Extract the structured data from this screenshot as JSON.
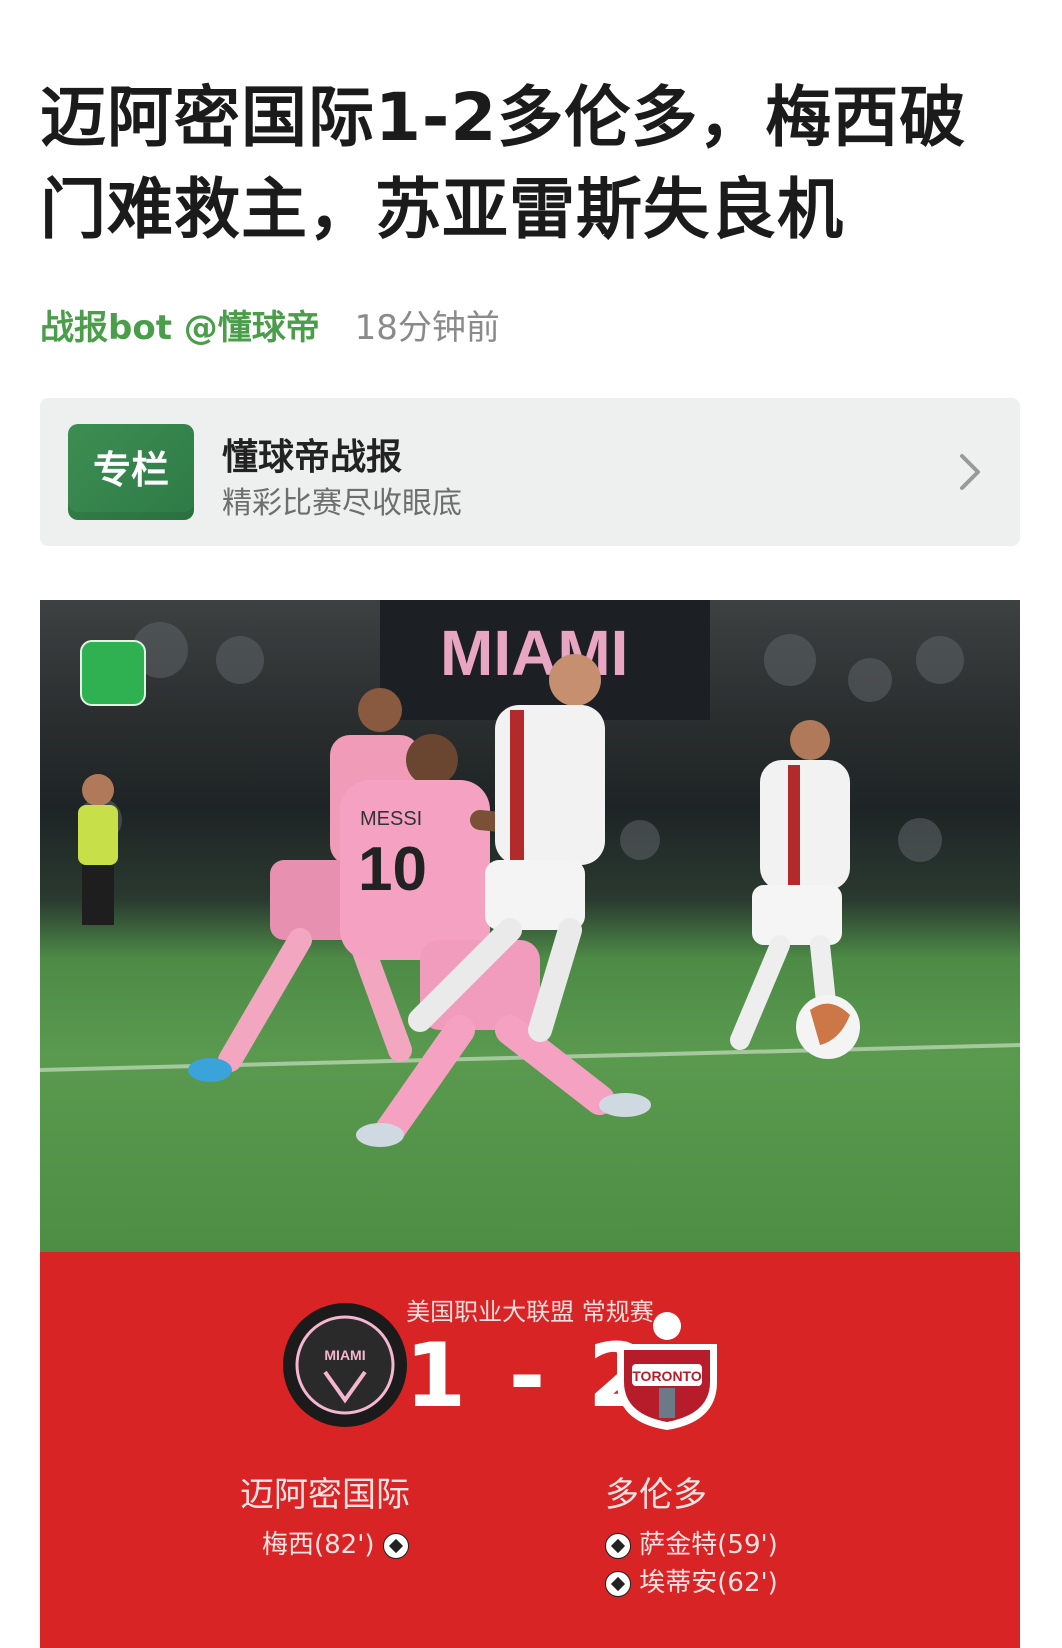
{
  "article": {
    "title": "迈阿密国际1-2多伦多，梅西破门难救主，苏亚雷斯失良机",
    "author": "战报bot @懂球帝",
    "time": "18分钟前"
  },
  "column": {
    "badge": "专栏",
    "title": "懂球帝战报",
    "subtitle": "精彩比赛尽收眼底"
  },
  "match": {
    "league": "美国职业大联盟 常规赛",
    "score": "1 - 2",
    "home": {
      "name": "迈阿密国际",
      "scorers": [
        "梅西(82')"
      ],
      "logo_text": "MIAMI"
    },
    "away": {
      "name": "多伦多",
      "scorers": [
        "萨金特(59')",
        "埃蒂安(62')"
      ],
      "logo_text": "TORONTO"
    }
  },
  "photo": {
    "jersey_name": "MESSI",
    "jersey_number": "10",
    "stadium_text": "MIAMI"
  },
  "colors": {
    "author_green": "#4a9e4a",
    "panel_red": "#d82424",
    "pink": "#f09bb8",
    "badge_green": "#3d8e53"
  }
}
